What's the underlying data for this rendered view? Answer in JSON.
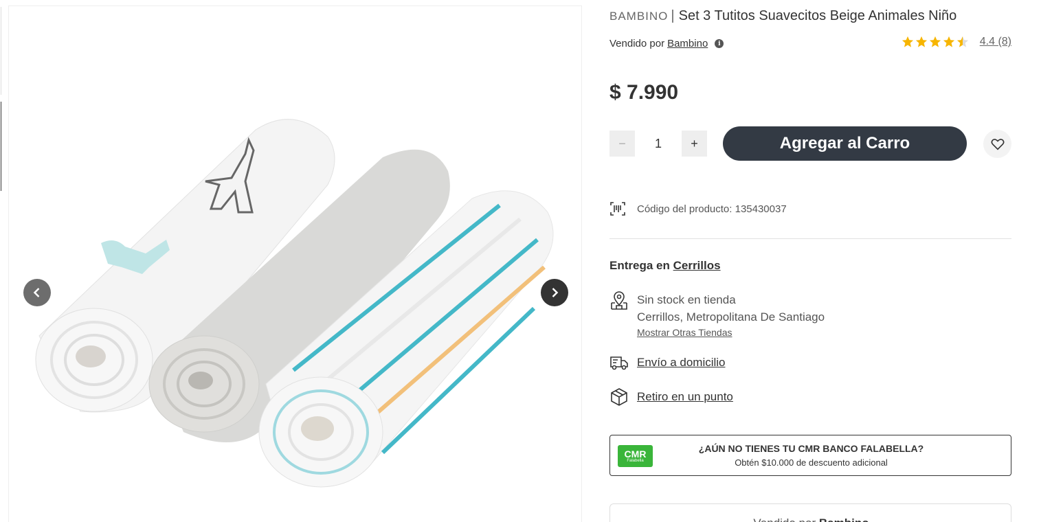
{
  "gallery": {
    "prev_label": "Previous image",
    "next_label": "Next image"
  },
  "product": {
    "brand": "BAMBINO",
    "separator": "|",
    "name": "Set 3 Tutitos Suavecitos Beige Animales Niño",
    "sold_by_prefix": "Vendido por",
    "seller": "Bambino",
    "rating": "4.4",
    "reviews": "(8)",
    "rating_stars": 4.4,
    "price": "$ 7.990",
    "code_label": "Código del producto: 135430037"
  },
  "cart": {
    "minus": "−",
    "qty": "1",
    "plus": "+",
    "add_label": "Agregar al Carro"
  },
  "delivery": {
    "prefix": "Entrega en",
    "location": "Cerrillos",
    "store_status": "Sin stock en tienda",
    "store_location": "Cerrillos, Metropolitana De Santiago",
    "store_link": "Mostrar Otras Tiendas",
    "home_delivery": "Envío a domicilio",
    "pickup": "Retiro en un punto"
  },
  "promo": {
    "logo_big": "CMR",
    "logo_small": "Falabella",
    "title": "¿AÚN NO TIENES TU CMR BANCO FALABELLA?",
    "subtitle": "Obtén $10.000 de descuento adicional"
  },
  "sold_box": {
    "prefix": "Vendido por",
    "seller": "Bambino"
  },
  "colors": {
    "primary_button": "#333a44",
    "star": "#f7b500",
    "cmr_green": "#3ab53a"
  }
}
